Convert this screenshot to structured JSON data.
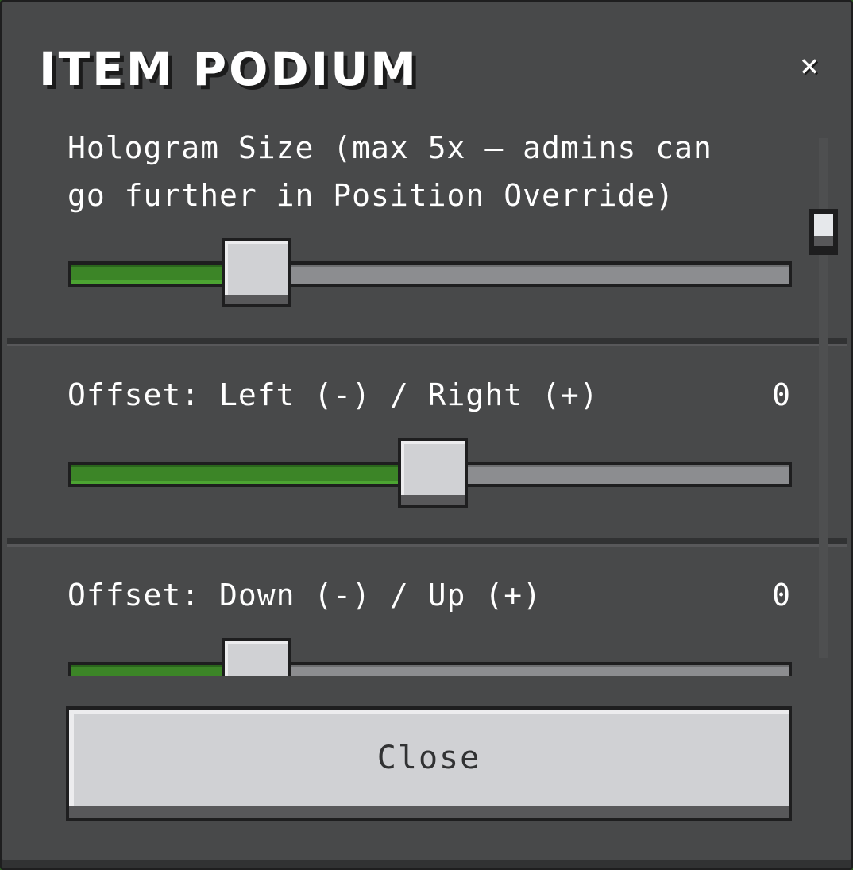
{
  "window": {
    "title": "ITEM PODIUM",
    "close_glyph": "×"
  },
  "sliders": [
    {
      "label": "Hologram Size (max 5x — admins can\ngo further in Position Override)",
      "value_text": "",
      "fraction": 0.23
    },
    {
      "label": "Offset: Left (-) / Right (+)",
      "value_text": "0",
      "fraction": 0.5
    },
    {
      "label": "Offset: Down (-) / Up (+)",
      "value_text": "0",
      "fraction": 0.23
    }
  ],
  "footer": {
    "close_label": "Close"
  },
  "colors": {
    "panel": "#48494a",
    "slider_fill": "#3c8527",
    "slider_track": "#8c8d90",
    "button_face": "#d0d1d4"
  }
}
